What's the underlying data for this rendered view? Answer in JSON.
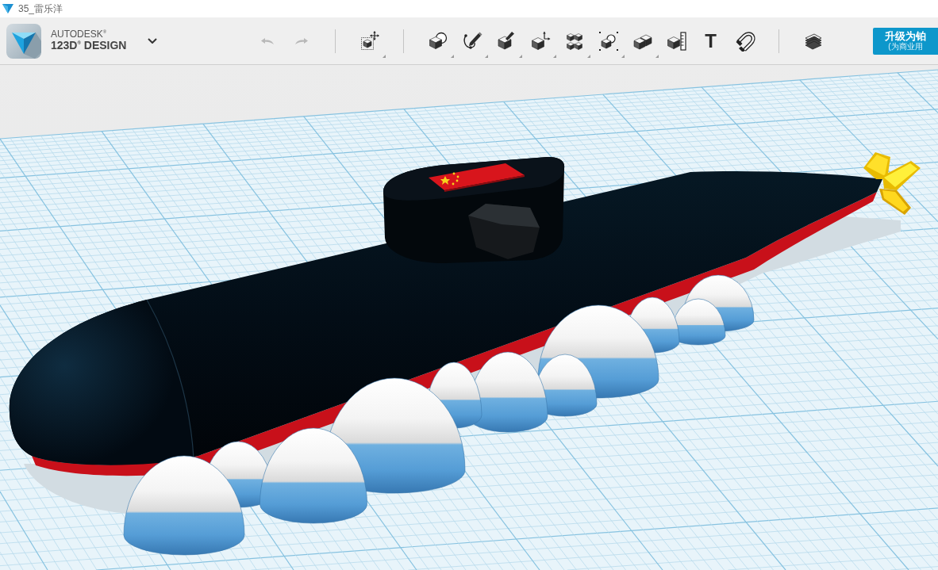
{
  "window": {
    "title": "35_雷乐洋"
  },
  "brand": {
    "company": "AUTODESK$^{®}$",
    "product": "123D$^{®}$ DESIGN"
  },
  "toolbar": {
    "history": [
      {
        "kind": "undo",
        "disabled": true
      },
      {
        "kind": "redo",
        "disabled": true
      }
    ],
    "tool_groups": [
      {
        "tools": [
          {
            "kind": "transform",
            "has_menu": true
          }
        ]
      },
      {
        "tools": [
          {
            "kind": "primitives",
            "has_menu": true
          },
          {
            "kind": "sketch",
            "has_menu": true
          },
          {
            "kind": "construct",
            "has_menu": true
          },
          {
            "kind": "modify",
            "has_menu": true
          },
          {
            "kind": "pattern",
            "has_menu": true
          },
          {
            "kind": "grouping",
            "has_menu": true
          },
          {
            "kind": "combine",
            "has_menu": true
          },
          {
            "kind": "measure",
            "has_menu": false
          },
          {
            "kind": "text",
            "label": "T",
            "has_menu": false
          },
          {
            "kind": "snap",
            "has_menu": false
          }
        ]
      },
      {
        "tools": [
          {
            "kind": "layers",
            "has_menu": false
          }
        ]
      }
    ]
  },
  "upgrade_button": {
    "label": "升级为铂",
    "sublabel": "(为商业用"
  }
}
